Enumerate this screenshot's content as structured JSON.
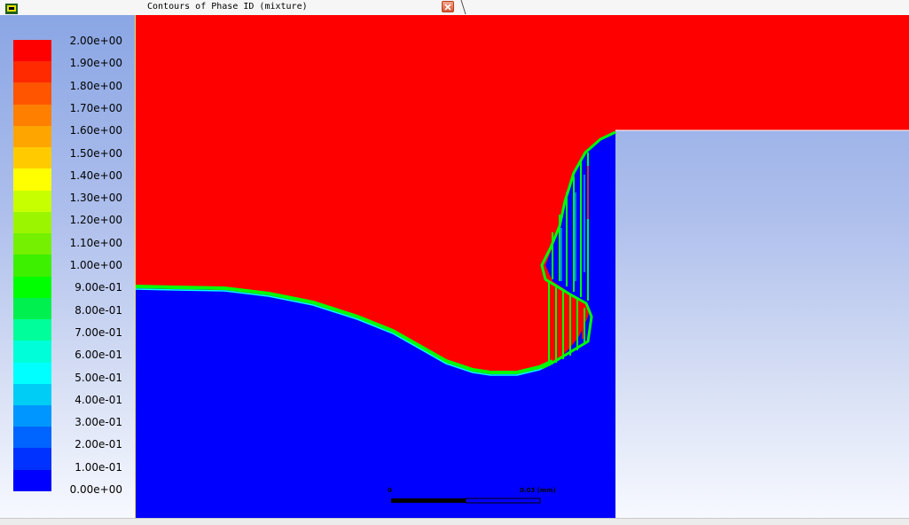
{
  "window": {
    "tab_title": "Contours of Phase ID (mixture)"
  },
  "icons": {
    "app": "fluent-app-icon",
    "close": "close-icon"
  },
  "legend": {
    "labels": [
      "2.00e+00",
      "1.90e+00",
      "1.80e+00",
      "1.70e+00",
      "1.60e+00",
      "1.50e+00",
      "1.40e+00",
      "1.30e+00",
      "1.20e+00",
      "1.10e+00",
      "1.00e+00",
      "9.00e-01",
      "8.00e-01",
      "7.00e-01",
      "6.00e-01",
      "5.00e-01",
      "4.00e-01",
      "3.00e-01",
      "2.00e-01",
      "1.00e-01",
      "0.00e+00"
    ],
    "colors": [
      "#ff0000",
      "#ff2a00",
      "#ff5500",
      "#ff7f00",
      "#ffa500",
      "#ffcb00",
      "#ffff00",
      "#c8ff00",
      "#9cf500",
      "#74f000",
      "#3cf000",
      "#00ff00",
      "#00f050",
      "#00ff9a",
      "#00ffd8",
      "#00ffff",
      "#00cdf5",
      "#0096ff",
      "#0064ff",
      "#0032ff",
      "#0000ff"
    ]
  },
  "scale_bar": {
    "start_label": "0",
    "end_label": "0.03 (mm)"
  },
  "colors": {
    "phase_high": "#ff0000",
    "phase_low": "#0000ff",
    "interface": "#00ff00"
  }
}
